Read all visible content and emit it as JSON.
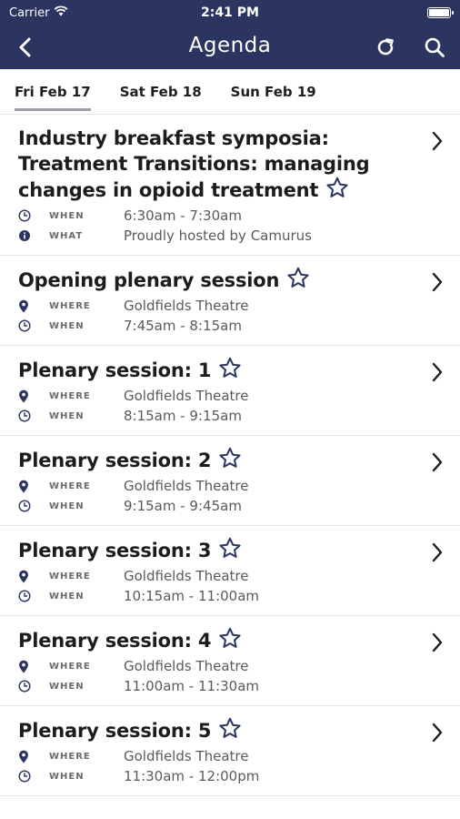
{
  "status": {
    "carrier": "Carrier",
    "time": "2:41 PM"
  },
  "nav": {
    "title": "Agenda"
  },
  "tabs": [
    {
      "label": "Fri Feb 17",
      "active": true
    },
    {
      "label": "Sat Feb 18",
      "active": false
    },
    {
      "label": "Sun Feb 19",
      "active": false
    }
  ],
  "sessions": [
    {
      "title": "Industry breakfast symposia: Treatment Transitions: managing changes in opioid treatment",
      "rows": [
        {
          "icon": "clock-icon",
          "label": "WHEN",
          "value": "6:30am - 7:30am"
        },
        {
          "icon": "info-icon",
          "label": "WHAT",
          "value": "Proudly hosted by Camurus"
        }
      ]
    },
    {
      "title": "Opening plenary session",
      "rows": [
        {
          "icon": "location-pin-icon",
          "label": "WHERE",
          "value": "Goldfields Theatre"
        },
        {
          "icon": "clock-icon",
          "label": "WHEN",
          "value": "7:45am - 8:15am"
        }
      ]
    },
    {
      "title": "Plenary session: 1",
      "rows": [
        {
          "icon": "location-pin-icon",
          "label": "WHERE",
          "value": "Goldfields Theatre"
        },
        {
          "icon": "clock-icon",
          "label": "WHEN",
          "value": "8:15am - 9:15am"
        }
      ]
    },
    {
      "title": "Plenary session: 2",
      "rows": [
        {
          "icon": "location-pin-icon",
          "label": "WHERE",
          "value": "Goldfields Theatre"
        },
        {
          "icon": "clock-icon",
          "label": "WHEN",
          "value": "9:15am - 9:45am"
        }
      ]
    },
    {
      "title": "Plenary session: 3",
      "rows": [
        {
          "icon": "location-pin-icon",
          "label": "WHERE",
          "value": "Goldfields Theatre"
        },
        {
          "icon": "clock-icon",
          "label": "WHEN",
          "value": "10:15am - 11:00am"
        }
      ]
    },
    {
      "title": "Plenary session: 4",
      "rows": [
        {
          "icon": "location-pin-icon",
          "label": "WHERE",
          "value": "Goldfields Theatre"
        },
        {
          "icon": "clock-icon",
          "label": "WHEN",
          "value": "11:00am - 11:30am"
        }
      ]
    },
    {
      "title": "Plenary session: 5",
      "rows": [
        {
          "icon": "location-pin-icon",
          "label": "WHERE",
          "value": "Goldfields Theatre"
        },
        {
          "icon": "clock-icon",
          "label": "WHEN",
          "value": "11:30am - 12:00pm"
        }
      ]
    }
  ],
  "colors": {
    "header": "#2b3560",
    "accent": "#2b3560"
  }
}
